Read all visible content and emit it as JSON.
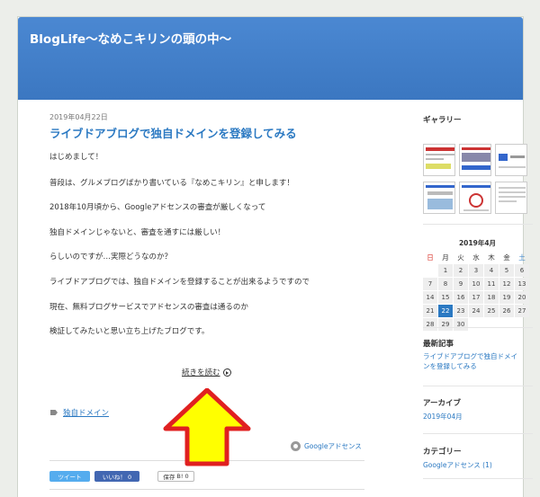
{
  "blog": {
    "title": "BlogLife〜なめこキリンの頭の中〜"
  },
  "post": {
    "date": "2019年04月22日",
    "title": "ライブドアブログで独自ドメインを登録してみる",
    "paragraphs": [
      "はじめまして！",
      "普段は、グルメブログばかり書いている『なめこキリン』と申します！",
      "2018年10月頃から、Googleアドセンスの審査が厳しくなって",
      "独自ドメインじゃないと、審査を通すには厳しい！",
      "らしいのですが…実際どうなのか？",
      "ライブドアブログでは、独自ドメインを登録することが出来るようですので",
      "現在、無料ブログサービスでアドセンスの審査は通るのか",
      "検証してみたいと思い立ち上げたブログです。"
    ],
    "read_more": "続きを読む",
    "tag": "独自ドメイン",
    "category": "Googleアドセンス"
  },
  "social": {
    "tweet": "ツイート",
    "like": "いいね！ 0",
    "hatena": "B! 0",
    "hatena_label": "保存"
  },
  "sidebar": {
    "gallery_title": "ギャラリー",
    "calendar": {
      "title": "2019年4月",
      "weekdays": [
        "日",
        "月",
        "火",
        "水",
        "木",
        "金",
        "土"
      ],
      "days": [
        "",
        "1",
        "2",
        "3",
        "4",
        "5",
        "6",
        "7",
        "8",
        "9",
        "10",
        "11",
        "12",
        "13",
        "14",
        "15",
        "16",
        "17",
        "18",
        "19",
        "20",
        "21",
        "22",
        "23",
        "24",
        "25",
        "26",
        "27",
        "28",
        "29",
        "30",
        "",
        "",
        "",
        ""
      ],
      "today": "22"
    },
    "recent_title": "最新記事",
    "recent_link": "ライブドアブログで独自ドメインを登録してみる",
    "archive_title": "アーカイブ",
    "archive_link": "2019年04月",
    "category_title": "カテゴリー",
    "category_link": "Googleアドセンス (1)"
  },
  "colors": {
    "header": "#3d7cc9",
    "link": "#2b79c2",
    "arrow_fill": "#ffff00",
    "arrow_stroke": "#e02020"
  }
}
